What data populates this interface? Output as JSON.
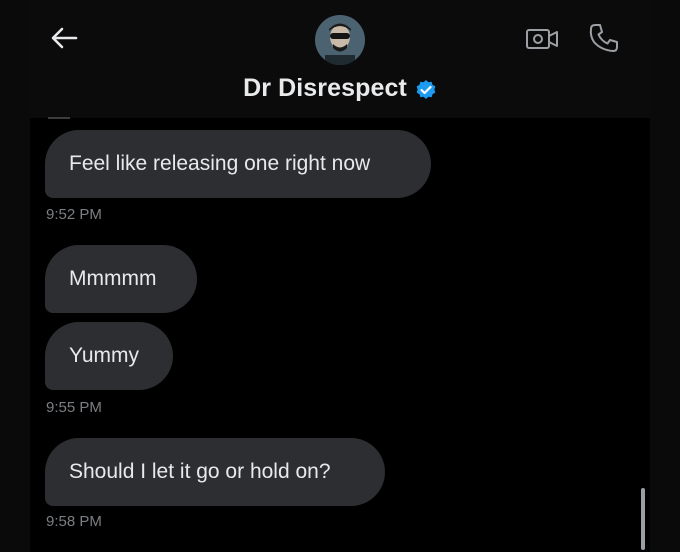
{
  "header": {
    "title": "Dr Disrespect",
    "verified": true
  },
  "messages": [
    {
      "text": "Feel like releasing one right now",
      "time": "9:52 PM"
    },
    {
      "text": "Mmmmm",
      "time": ""
    },
    {
      "text": "Yummy",
      "time": "9:55 PM"
    },
    {
      "text": "Should I let it go or hold on?",
      "time": "9:58 PM"
    }
  ],
  "colors": {
    "background": "#000000",
    "bubble": "#2c2e31",
    "text": "#e7e9ea",
    "timestamp": "#7b7f83",
    "verified": "#1d9bf0"
  },
  "icons": [
    "back-arrow-icon",
    "video-call-icon",
    "phone-icon",
    "verified-badge-icon"
  ]
}
